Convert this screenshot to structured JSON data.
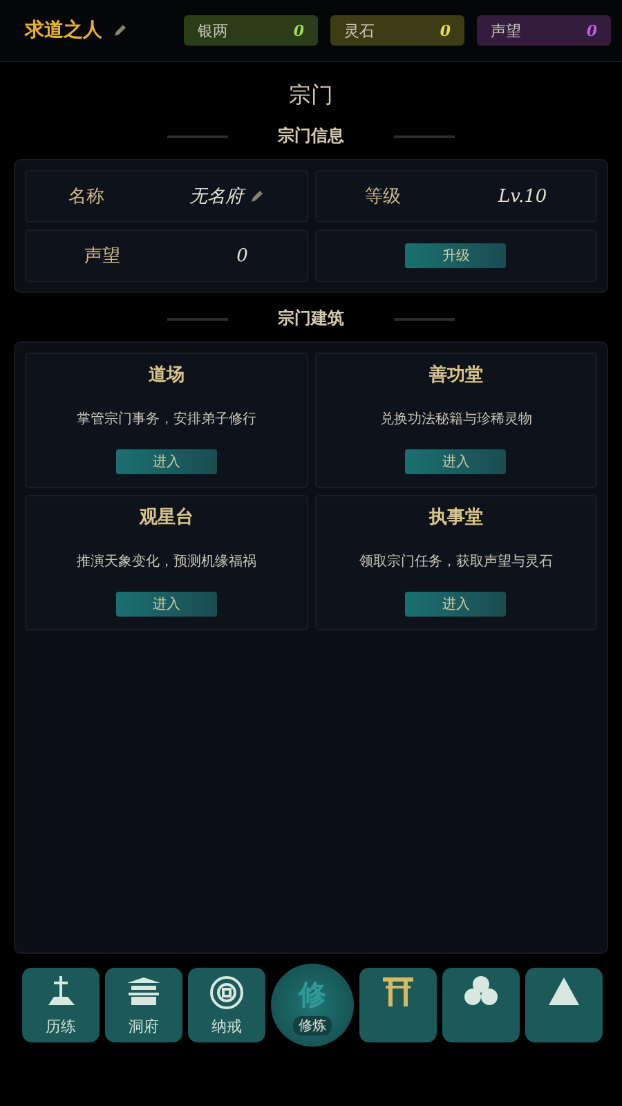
{
  "header": {
    "player_name": "求道之人",
    "currencies": [
      {
        "label": "银两",
        "value": "0",
        "color": "#9be04a"
      },
      {
        "label": "灵石",
        "value": "0",
        "color": "#e8e040"
      },
      {
        "label": "声望",
        "value": "0",
        "color": "#c060e0"
      }
    ]
  },
  "title": "宗门",
  "info_section": {
    "heading": "宗门信息",
    "fields": [
      {
        "kind": "editable",
        "label": "名称",
        "value": "无名府"
      },
      {
        "kind": "plain",
        "label": "等级",
        "value": "Lv.10"
      },
      {
        "kind": "plain",
        "label": "声望",
        "value": "0"
      },
      {
        "kind": "action",
        "button": "升级"
      }
    ]
  },
  "buildings_section": {
    "heading": "宗门建筑",
    "buildings": [
      {
        "name": "道场",
        "description": "掌管宗门事务，安排弟子修行",
        "button": "进入"
      },
      {
        "name": "善功堂",
        "description": "兑换功法秘籍与珍稀灵物",
        "button": "进入"
      },
      {
        "name": "观星台",
        "description": "推演天象变化，预测机缘福祸",
        "button": "进入"
      },
      {
        "name": "执事堂",
        "description": "领取宗门任务，获取声望与灵石",
        "button": "进入"
      }
    ]
  },
  "bottom_nav": [
    {
      "kind": "tile",
      "label": "历练"
    },
    {
      "kind": "tile",
      "label": "洞府"
    },
    {
      "kind": "tile",
      "label": "纳戒"
    },
    {
      "kind": "round",
      "glyph": "修",
      "label": "修炼"
    },
    {
      "kind": "tile"
    },
    {
      "kind": "tile"
    },
    {
      "kind": "tile"
    }
  ]
}
